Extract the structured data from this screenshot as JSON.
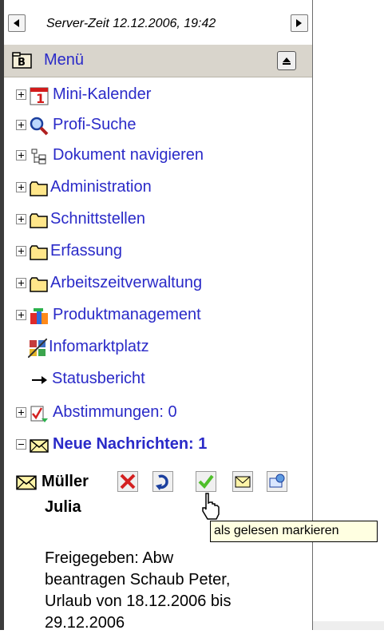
{
  "timebar": {
    "text": "Server-Zeit 12.12.2006, 19:42"
  },
  "menu": {
    "title": "Menü"
  },
  "tree": {
    "items": [
      {
        "label": "Mini-Kalender",
        "icon": "calendar-icon"
      },
      {
        "label": "Profi-Suche",
        "icon": "magnifier-icon"
      },
      {
        "label": "Dokument navigieren",
        "icon": "tree-structure-icon"
      },
      {
        "label": "Administration",
        "icon": "folder-icon"
      },
      {
        "label": "Schnittstellen",
        "icon": "folder-icon"
      },
      {
        "label": "Erfassung",
        "icon": "folder-icon"
      },
      {
        "label": "Arbeitszeitverwaltung",
        "icon": "folder-icon"
      },
      {
        "label": "Produktmanagement",
        "icon": "product-icon"
      },
      {
        "label": "Infomarktplatz",
        "icon": "marketplace-icon"
      },
      {
        "label": "Statusbericht",
        "icon": "arrow-right-icon"
      },
      {
        "label": "Abstimmungen: 0",
        "icon": "vote-icon"
      },
      {
        "label": "Neue Nachrichten: 1",
        "icon": "envelope-icon"
      }
    ]
  },
  "message": {
    "sender_last": "Müller",
    "sender_first": "Julia",
    "body_line1": "Freigegeben: Abw",
    "body_line2": "beantragen Schaub Peter,",
    "body_line3": "Urlaub von 18.12.2006 bis",
    "body_line4": "29.12.2006",
    "actions": [
      "delete-icon",
      "reply-icon",
      "mark-read-icon",
      "envelope-icon",
      "forward-icon"
    ]
  },
  "tooltip": {
    "text": "als gelesen markieren"
  },
  "colors": {
    "link": "#2a2ac8",
    "menu_header_bg": "#d9d5cc",
    "tooltip_bg": "#ffffe1"
  }
}
